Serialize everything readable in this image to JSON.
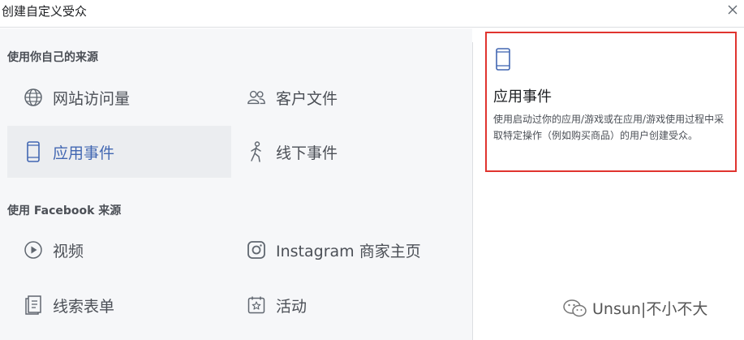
{
  "dialog": {
    "title": "创建自定义受众",
    "close_icon": "close-icon"
  },
  "own_sources": {
    "heading": "使用你自己的来源",
    "items": [
      {
        "label": "网站访问量",
        "icon": "globe-icon"
      },
      {
        "label": "客户文件",
        "icon": "people-icon"
      },
      {
        "label": "应用事件",
        "icon": "mobile-phone-icon",
        "selected": true
      },
      {
        "label": "线下事件",
        "icon": "walking-person-icon"
      }
    ]
  },
  "facebook_sources": {
    "heading": "使用 Facebook 来源",
    "items": [
      {
        "label": "视频",
        "icon": "play-circle-icon"
      },
      {
        "label": "Instagram 商家主页",
        "icon": "instagram-icon"
      },
      {
        "label": "线索表单",
        "icon": "lead-form-icon"
      },
      {
        "label": "活动",
        "icon": "event-star-icon"
      }
    ]
  },
  "detail": {
    "icon": "mobile-phone-icon",
    "title": "应用事件",
    "description": "使用启动过你的应用/游戏或在应用/游戏使用过程中采取特定操作（例如购买商品）的用户创建受众。"
  },
  "watermark": {
    "icon": "wechat-icon",
    "text": "Unsun|不小不大"
  },
  "colors": {
    "selected_text": "#4267b2",
    "selected_bg": "#ebedf0",
    "highlight_border": "#e0342f",
    "panel_bg": "#f6f7f9"
  }
}
